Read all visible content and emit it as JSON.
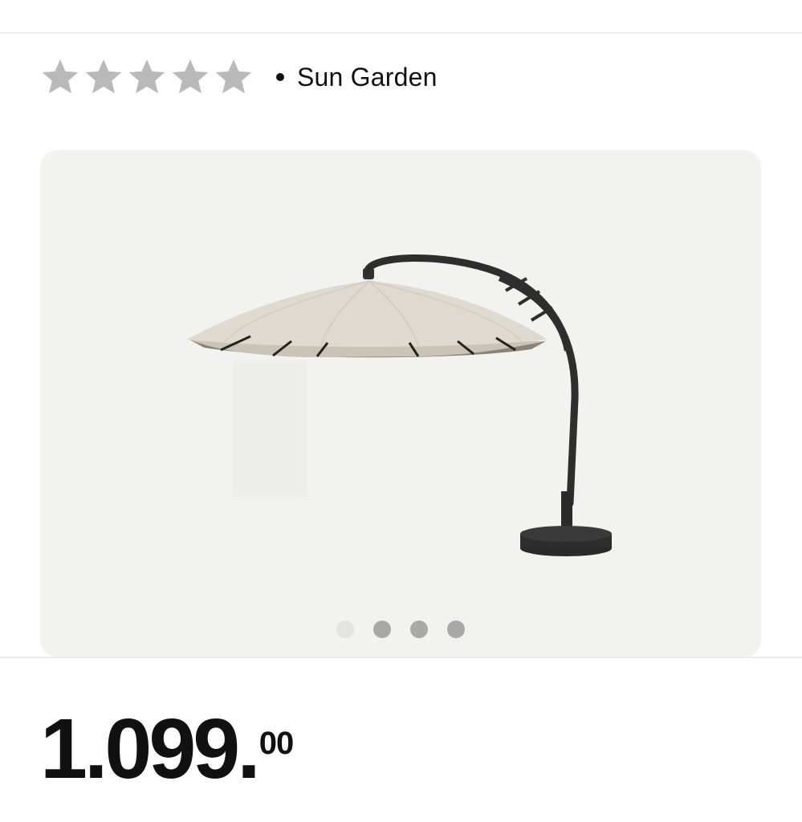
{
  "rating": {
    "stars_total": 5,
    "stars_filled": 0,
    "star_color": "#b9b9b9"
  },
  "brand": {
    "name": "Sun Garden"
  },
  "gallery": {
    "background_color": "#f2f2f1",
    "image_icon": "cantilever-parasol-image",
    "slide_count": 4,
    "active_slide": 1
  },
  "price": {
    "main": "1.099.",
    "decimal": "00"
  }
}
